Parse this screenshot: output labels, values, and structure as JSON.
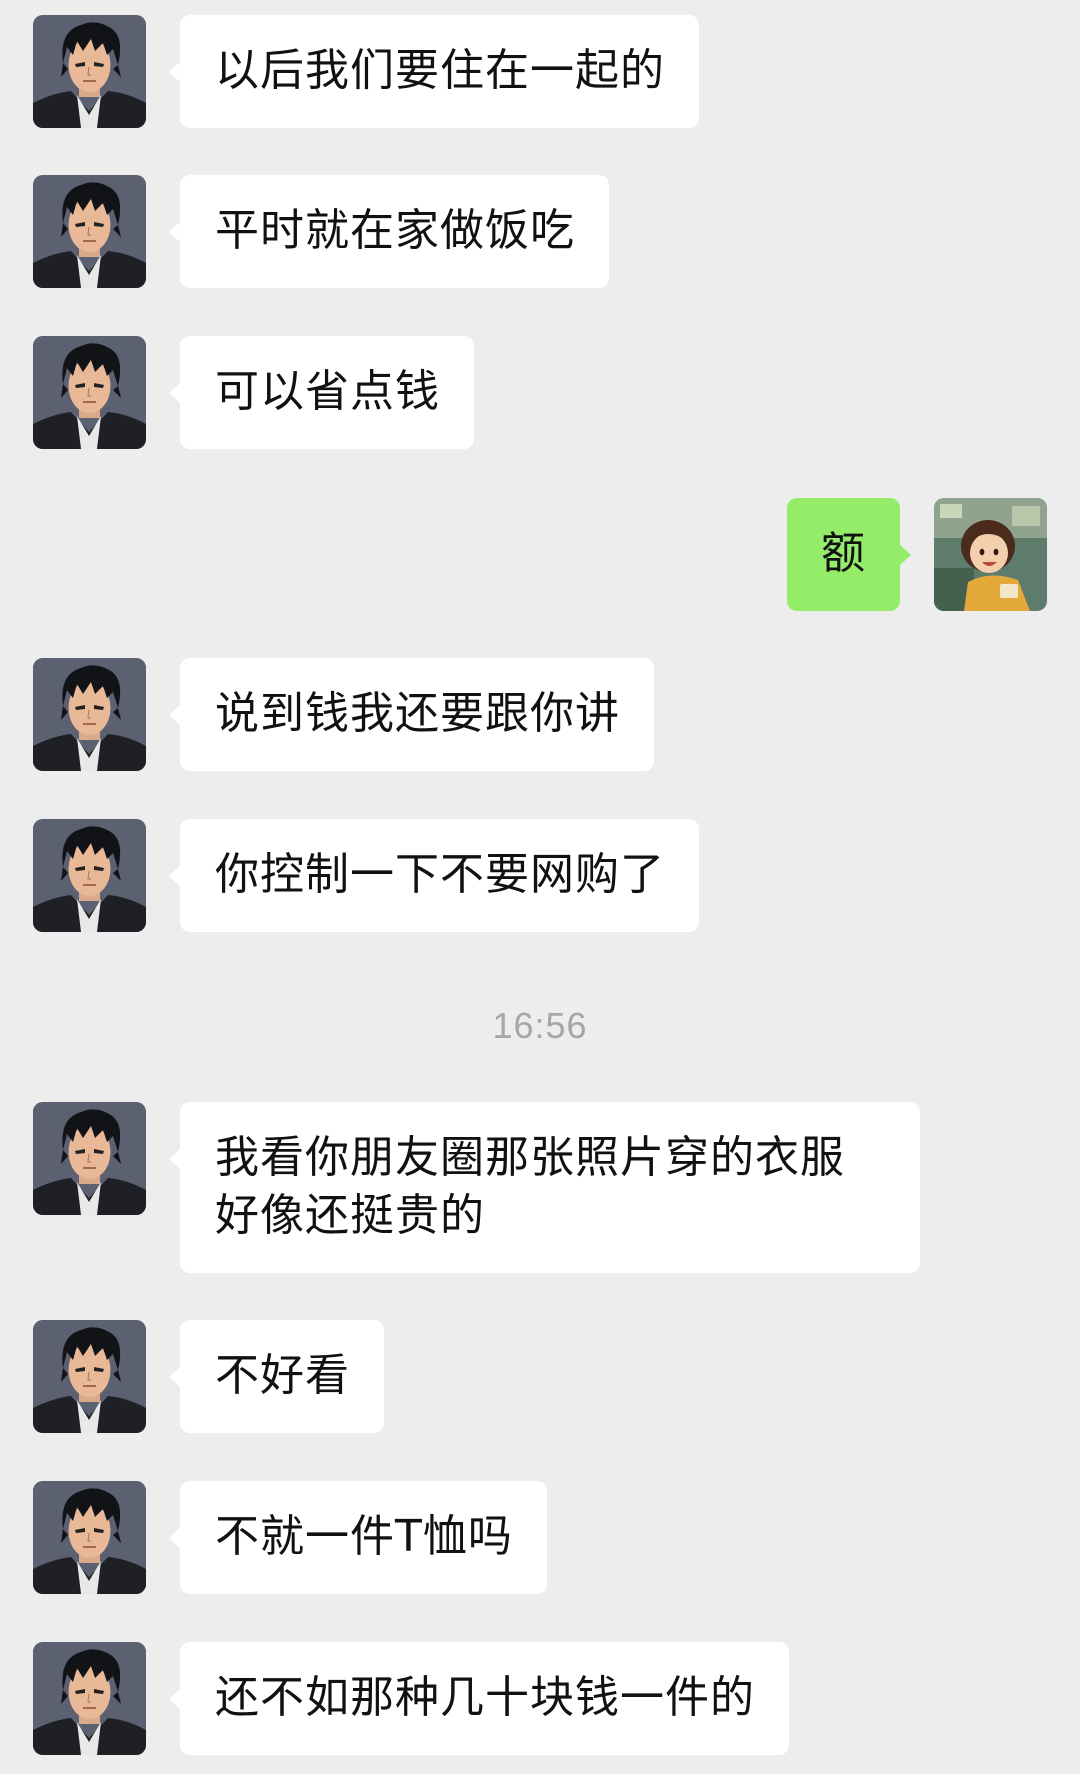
{
  "timestamp": "16:56",
  "avatars": {
    "contact": "man-dark-hair-avatar",
    "self": "girl-anime-avatar"
  },
  "messages": [
    {
      "from": "contact",
      "text": "以后我们要住在一起的"
    },
    {
      "from": "contact",
      "text": "平时就在家做饭吃"
    },
    {
      "from": "contact",
      "text": "可以省点钱"
    },
    {
      "from": "self",
      "text": "额"
    },
    {
      "from": "contact",
      "text": "说到钱我还要跟你讲"
    },
    {
      "from": "contact",
      "text": "你控制一下不要网购了"
    },
    {
      "from": "contact",
      "text": "我看你朋友圈那张照片穿的衣服好像还挺贵的"
    },
    {
      "from": "contact",
      "text": "不好看"
    },
    {
      "from": "contact",
      "text": "不就一件T恤吗"
    },
    {
      "from": "contact",
      "text": "还不如那种几十块钱一件的"
    }
  ],
  "colors": {
    "background": "#ededed",
    "bubble_contact": "#ffffff",
    "bubble_self": "#95ec69",
    "timestamp": "#a6a6a6"
  }
}
